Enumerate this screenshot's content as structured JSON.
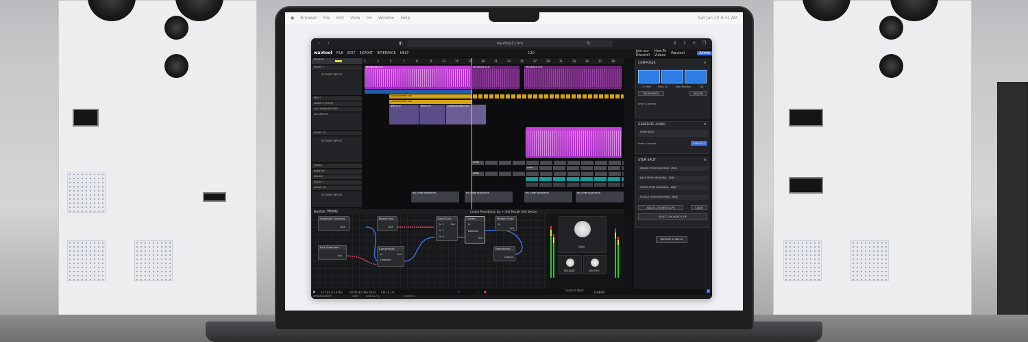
{
  "os": {
    "menu": [
      "Browser",
      "File",
      "Edit",
      "View",
      "Go",
      "Window",
      "Help"
    ],
    "clock": "Sat Jun 10  9:41 AM"
  },
  "browser": {
    "url": "wavtool.com"
  },
  "app": {
    "logo": "wavtool",
    "menu": [
      "FILE",
      "EDIT",
      "EXPORT",
      "INTERFACE",
      "HELP"
    ],
    "bpm": "120",
    "right_links": [
      "Join our Discord!",
      "How-To Videos",
      "Wavtool"
    ],
    "upgrade_label": "",
    "account_label": "Admin"
  },
  "ruler": {
    "bars": [
      "1",
      "3",
      "5",
      "7",
      "9",
      "11",
      "13",
      "15",
      "17",
      "19",
      "21",
      "23",
      "25",
      "27",
      "29",
      "31",
      "33",
      "35",
      "37",
      "39"
    ]
  },
  "tracks": [
    {
      "name": "MASTER"
    },
    {
      "name": "AUDIO 1"
    },
    {
      "name": "ACTIVATE INPUTS"
    },
    {
      "name": "MIDI 1"
    },
    {
      "name": "AUDIO 5 (COPY)"
    },
    {
      "name": "LOFI SAMPLER KEYS"
    },
    {
      "name": "ALL INPUTS"
    },
    {
      "name": "AUDIO 12"
    },
    {
      "name": "ACTIVATE INPUTS"
    },
    {
      "name": "OTHER"
    },
    {
      "name": "SUBSTEP"
    },
    {
      "name": "DRUMS"
    },
    {
      "name": "AUDIO 7"
    },
    {
      "name": "AUDIO 13"
    },
    {
      "name": "ACTIVATE INPUTS"
    }
  ],
  "clips": {
    "recorded": "RECORDED CLIP",
    "consolidated": "CONSOLIDATED CLIP",
    "new": "NEW CLIP",
    "cymb": "CYMB",
    "conc": "CONC",
    "transition": "BIG CYMB TRANSITION"
  },
  "composer": {
    "title": "COMPOSER",
    "options": [
      "On MINI",
      "Multi-Ch",
      "New Rhythm",
      "8X"
    ],
    "regenerate": "REGENERATE",
    "mode": "MELODY",
    "prompt_placeholder": "Enter a prompt"
  },
  "generate_audio": {
    "title": "GENERATE AUDIO",
    "clip_name": "FUNKY BEAT",
    "prompt_placeholder": "Enter a prompt",
    "button": "GENERATE"
  },
  "stem_split": {
    "title": "STEM SPLIT",
    "stems": [
      "DRUMS FROM GROOVING - MIDE",
      "BASS FROM GROOVING - MIDE",
      "OTHER FROM GROOVING - MIDE",
      "VOCALS FROM GROOVING - MIDE"
    ],
    "add_all": "ADD ALL AS NEW CLIPS",
    "clear": "CLEAR",
    "select": "SELECT AN AUDIO CLIP",
    "browse": "BROWSE AI SKILLS"
  },
  "graph": {
    "target": "MASTER",
    "preset": "Melody",
    "actions": [
      "Create Preset",
      "Clean Up",
      "+ Add Portal",
      "+ Add Device"
    ],
    "nodes": [
      {
        "title": "Sidechain Subrenis",
        "ports": [
          "Out"
        ]
      },
      {
        "title": "Master Bus",
        "ports": [
          "Out"
        ]
      },
      {
        "title": "Band Sum",
        "ports": [
          "In 1",
          "In 2",
          "In 3",
          "Out"
        ]
      },
      {
        "title": "Limiter",
        "ports": [
          "In",
          "Detector",
          "Out"
        ]
      },
      {
        "title": "Master Fader",
        "ports": [
          "In",
          "Out"
        ]
      },
      {
        "title": "Kick Sidechain",
        "ports": [
          "Out"
        ]
      },
      {
        "title": "Compressor",
        "ports": [
          "In",
          "Detector",
          "Out"
        ]
      },
      {
        "title": "Metronome",
        "ports": [
          "Output"
        ]
      }
    ],
    "knobs": [
      "GAIN",
      "RELEASE",
      "SMOOTH"
    ]
  },
  "status": {
    "position": "017.01.01.4763",
    "time": "00:00:32.096.0023",
    "cpu": "CPU 4.1%",
    "countin": "Count-In Beat",
    "zoom": "128BPM",
    "mode": "ARRANGEMENT",
    "shift": "SHIFT",
    "scroll": "SCROLL +/-",
    "zoom_label": "ZOOM +/-"
  },
  "colors": {
    "accent": "#3b6ddd",
    "upgrade": "#f0a800",
    "audio_clip": "#c542d4",
    "midi_clip": "#1f5ea8",
    "consolidated": "#d4a414"
  }
}
